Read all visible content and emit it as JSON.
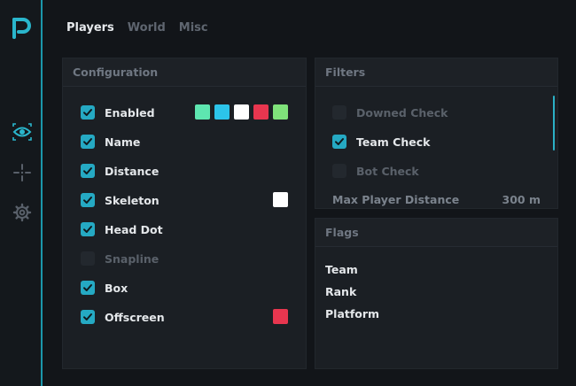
{
  "tabs": [
    {
      "label": "Players",
      "active": true
    },
    {
      "label": "World",
      "active": false
    },
    {
      "label": "Misc",
      "active": false
    }
  ],
  "sidebar": {
    "icons": [
      "eye-icon",
      "crosshair-icon",
      "gear-icon"
    ],
    "active_icon": "eye-icon"
  },
  "configuration": {
    "title": "Configuration",
    "items": [
      {
        "label": "Enabled",
        "checked": true,
        "colors": [
          "#5ee6b0",
          "#2cc4ea",
          "#ffffff",
          "#e8364f",
          "#7fe27a"
        ]
      },
      {
        "label": "Name",
        "checked": true,
        "colors": []
      },
      {
        "label": "Distance",
        "checked": true,
        "colors": []
      },
      {
        "label": "Skeleton",
        "checked": true,
        "colors": [
          "#ffffff"
        ]
      },
      {
        "label": "Head Dot",
        "checked": true,
        "colors": []
      },
      {
        "label": "Snapline",
        "checked": false,
        "colors": []
      },
      {
        "label": "Box",
        "checked": true,
        "colors": []
      },
      {
        "label": "Offscreen",
        "checked": true,
        "colors": [
          "#e8364f"
        ]
      }
    ]
  },
  "filters": {
    "title": "Filters",
    "items": [
      {
        "label": "Downed Check",
        "checked": false
      },
      {
        "label": "Team Check",
        "checked": true
      },
      {
        "label": "Bot Check",
        "checked": false
      }
    ],
    "max_distance_label": "Max Player Distance",
    "max_distance_value": "300 m"
  },
  "flags": {
    "title": "Flags",
    "items": [
      "Team",
      "Rank",
      "Platform"
    ]
  },
  "colors": {
    "accent": "#25a9c3",
    "panel_bg": "#1b1f24",
    "window_bg": "#121519"
  }
}
